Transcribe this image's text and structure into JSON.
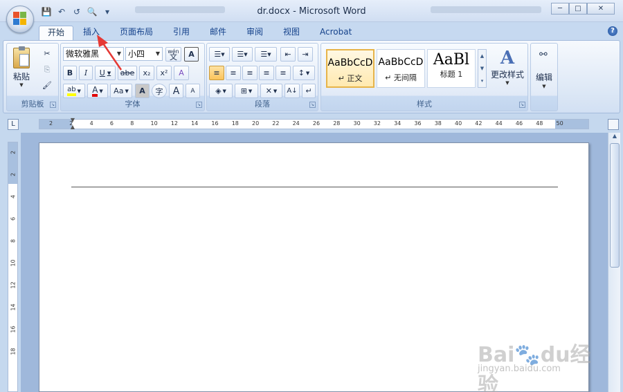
{
  "window": {
    "title": "dr.docx - Microsoft Word",
    "minimize": "─",
    "maximize": "□",
    "close": "✕"
  },
  "qat": {
    "save": "💾",
    "undo": "↶",
    "redo": "↺",
    "print_preview": "🔍",
    "customize": "▾"
  },
  "tabs": [
    {
      "label": "开始",
      "active": true
    },
    {
      "label": "插入",
      "active": false
    },
    {
      "label": "页面布局",
      "active": false
    },
    {
      "label": "引用",
      "active": false
    },
    {
      "label": "邮件",
      "active": false
    },
    {
      "label": "审阅",
      "active": false
    },
    {
      "label": "视图",
      "active": false
    },
    {
      "label": "Acrobat",
      "active": false
    }
  ],
  "help": "?",
  "clipboard": {
    "label": "剪贴板",
    "paste": "粘贴",
    "cut": "✂",
    "copy": "⎘",
    "format_painter": "🖌"
  },
  "font": {
    "label": "字体",
    "font_name": "微软雅黑",
    "font_size": "小四",
    "pinyin": "wén",
    "border_char": "A",
    "bold": "B",
    "italic": "I",
    "underline": "U",
    "strikethrough": "abe",
    "subscript": "x₂",
    "superscript": "x²",
    "clear_format": "A",
    "highlight": "ab",
    "font_color": "A",
    "change_case": "Aa",
    "char_shading": "A",
    "enclose": "字",
    "grow": "A",
    "shrink": "A"
  },
  "paragraph": {
    "label": "段落",
    "bullets": "☰",
    "numbering": "☰",
    "multilevel": "☰",
    "decrease_indent": "⇤",
    "increase_indent": "⇥",
    "align_left": "≡",
    "center": "≡",
    "align_right": "≡",
    "justify": "≡",
    "distributed": "≡",
    "line_spacing": "↕",
    "shading": "◈",
    "borders": "⊞",
    "chinese_layout": "✕",
    "sort": "A↓",
    "show_marks": "↵"
  },
  "styles": {
    "label": "样式",
    "items": [
      {
        "sample": "AaBbCcD",
        "name": "↵ 正文"
      },
      {
        "sample": "AaBbCcD",
        "name": "↵ 无间隔"
      },
      {
        "sample": "AaBl",
        "name": "标题 1"
      }
    ],
    "change_styles": "更改样式"
  },
  "editing": {
    "label": "编辑"
  },
  "ruler": {
    "corner": "L",
    "ticks": [
      "2",
      "2",
      "4",
      "6",
      "8",
      "10",
      "12",
      "14",
      "16",
      "18",
      "20",
      "22",
      "24",
      "26",
      "28",
      "30",
      "32",
      "34",
      "36",
      "38",
      "40",
      "42",
      "44",
      "46",
      "48",
      "50"
    ],
    "vticks": [
      "2",
      "2",
      "4",
      "6",
      "8",
      "10",
      "12",
      "14",
      "16",
      "18"
    ]
  },
  "watermark": {
    "brand": "Bai🐾du经验",
    "sub": "jingyan.baidu.com"
  },
  "colors": {
    "accent": "#15428b",
    "annotation_arrow": "#e53935",
    "font_color_bar": "#e00000",
    "highlight_bar": "#ffff00"
  }
}
